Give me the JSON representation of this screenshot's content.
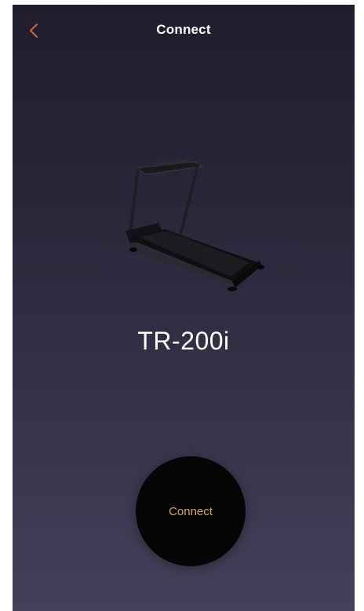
{
  "header": {
    "title": "Connect",
    "back_icon": "chevron-left-icon"
  },
  "device": {
    "model": "TR-200i",
    "image_icon": "treadmill-icon"
  },
  "actions": {
    "connect_label": "Connect"
  },
  "colors": {
    "accent": "#d9a84f",
    "back_arrow": "#c8634a",
    "button_bg": "#050505",
    "bg_top": "#211d2c",
    "bg_bottom": "#45405a"
  }
}
